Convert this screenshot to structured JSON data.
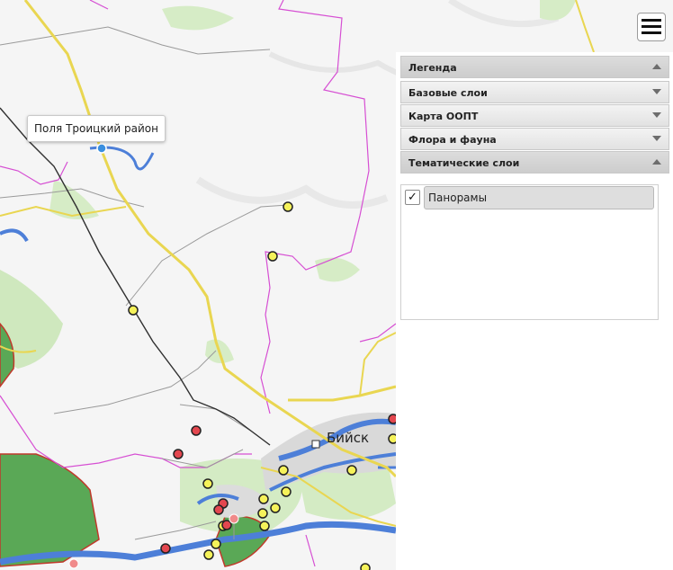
{
  "map": {
    "popup_label": "Поля Троицкий район",
    "city_label": "Бийск",
    "colors": {
      "background": "#f6f6f6",
      "road_major": "#e9d651",
      "road_minor": "#8f8f8f",
      "railway": "#303030",
      "border": "#d64fd3",
      "river": "#4d7fd8",
      "protected_area": "#58a856",
      "forest": "#c8e6b5",
      "city": "#d8d8d8",
      "panorama_marker": "#f5f25a",
      "poi_marker": "#e3474f"
    }
  },
  "menu": {
    "icon": "hamburger-menu-icon"
  },
  "panel": {
    "sections": [
      {
        "label": "Легенда",
        "state": "open"
      },
      {
        "label": "Базовые слои",
        "state": "collapsed"
      },
      {
        "label": "Карта ООПТ",
        "state": "collapsed"
      },
      {
        "label": "Флора и фауна",
        "state": "collapsed"
      },
      {
        "label": "Тематические слои",
        "state": "open"
      }
    ],
    "layers": [
      {
        "label": "Панорамы",
        "checked": true,
        "check_mark": "✓"
      }
    ]
  }
}
